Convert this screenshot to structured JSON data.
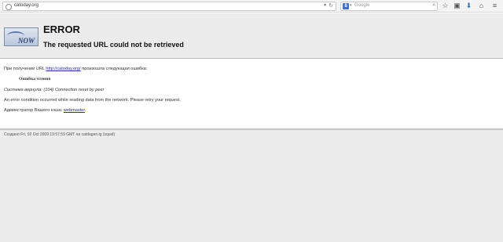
{
  "toolbar": {
    "url": "catoday.org",
    "search_placeholder": "Google",
    "search_engine_letter": "8"
  },
  "header": {
    "title": "ERROR",
    "subtitle": "The requested URL could not be retrieved",
    "logo_text": "NOW"
  },
  "body": {
    "line1_prefix": "При получении URL ",
    "line1_link": "http://catoday.org/",
    "line1_suffix": " произошла следующая ошибка:",
    "error_name": "Ошибка чтения",
    "system_return": "Система вернула: (104) Connection reset by peer",
    "description": "An error condition occurred while reading data from the network. Please retry your request.",
    "admin_prefix": "Админстратор Вашего кэша: ",
    "admin_link": "webmaster",
    "admin_suffix": "."
  },
  "footer": {
    "generated": "Создано Fri, 02 Oct 2009 19:57:59 GMT на catdagen.ig (squid)"
  }
}
